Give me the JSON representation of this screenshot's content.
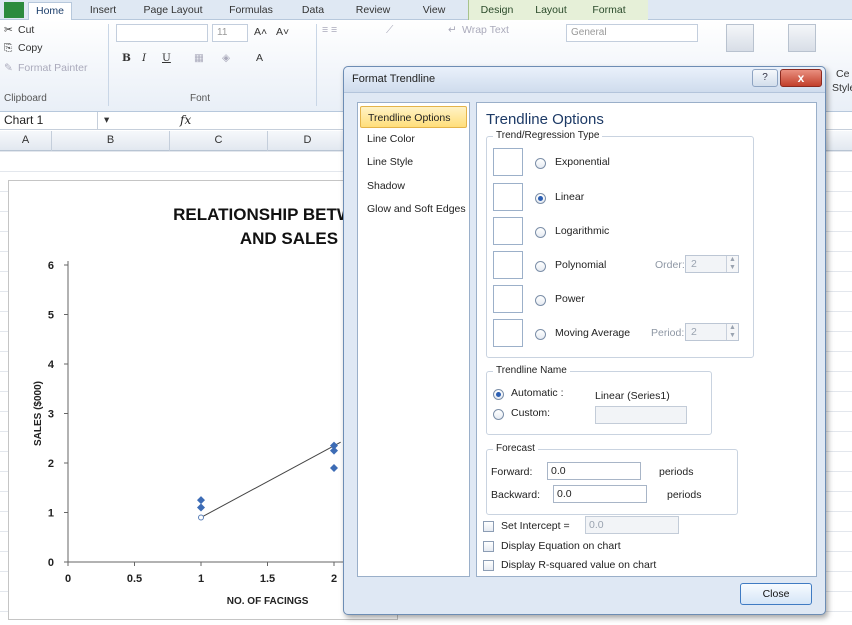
{
  "ribbon": {
    "tabs": [
      "Home",
      "Insert",
      "Page Layout",
      "Formulas",
      "Data",
      "Review",
      "View",
      "Design",
      "Layout",
      "Format"
    ],
    "clipboard": {
      "cut": "Cut",
      "copy": "Copy",
      "format_painter": "Format Painter",
      "group_label": "Clipboard"
    },
    "font": {
      "size": "11",
      "bold": "B",
      "italic": "I",
      "underline": "U",
      "grow": "A˄",
      "shrink": "A˅",
      "font_color": "A",
      "group_label": "Font"
    },
    "alignment": {
      "wrap_text": "Wrap Text"
    },
    "number": {
      "format": "General"
    },
    "styles": {
      "cell_styles_a": "Ce",
      "cell_styles_b": "Style"
    }
  },
  "formula_bar": {
    "name_box": "Chart 1",
    "fx": "fx"
  },
  "columns": [
    "A",
    "B",
    "C",
    "D"
  ],
  "chart_data": {
    "type": "scatter",
    "title_line1": "RELATIONSHIP BETWEEN N",
    "title_line2": "AND SALES",
    "xlabel": "NO. OF FACINGS",
    "ylabel": "SALES ($000)",
    "x_ticks": [
      "0",
      "0.5",
      "1",
      "1.5",
      "2"
    ],
    "y_ticks": [
      "0",
      "1",
      "2",
      "3",
      "4",
      "5",
      "6"
    ],
    "xlim": [
      0,
      2.5
    ],
    "ylim": [
      0,
      6
    ],
    "points": [
      {
        "x": 1,
        "y": 1.1
      },
      {
        "x": 1,
        "y": 1.25
      },
      {
        "x": 2,
        "y": 1.9
      },
      {
        "x": 2,
        "y": 2.25
      },
      {
        "x": 2,
        "y": 2.35
      }
    ],
    "trendline": {
      "type": "linear",
      "x": [
        1,
        2.05
      ],
      "y": [
        0.9,
        2.42
      ]
    }
  },
  "dialog": {
    "title": "Format Trendline",
    "help": "?",
    "close_x": "x",
    "nav": [
      "Trendline Options",
      "Line Color",
      "Line Style",
      "Shadow",
      "Glow and Soft Edges"
    ],
    "heading": "Trendline Options",
    "type_group": "Trend/Regression Type",
    "types": [
      "Exponential",
      "Linear",
      "Logarithmic",
      "Polynomial",
      "Power",
      "Moving Average"
    ],
    "selected_type": "Linear",
    "order_label": "Order:",
    "order_value": "2",
    "period_label": "Period:",
    "period_value": "2",
    "name_group": "Trendline Name",
    "automatic_label": "Automatic :",
    "automatic_value": "Linear (Series1)",
    "custom_label": "Custom:",
    "forecast_group": "Forecast",
    "forward_label": "Forward:",
    "forward_value": "0.0",
    "backward_label": "Backward:",
    "backward_value": "0.0",
    "periods": "periods",
    "set_intercept": "Set Intercept =",
    "intercept_value": "0.0",
    "display_equation": "Display Equation on chart",
    "display_r2": "Display R-squared value on chart",
    "close_button": "Close"
  }
}
